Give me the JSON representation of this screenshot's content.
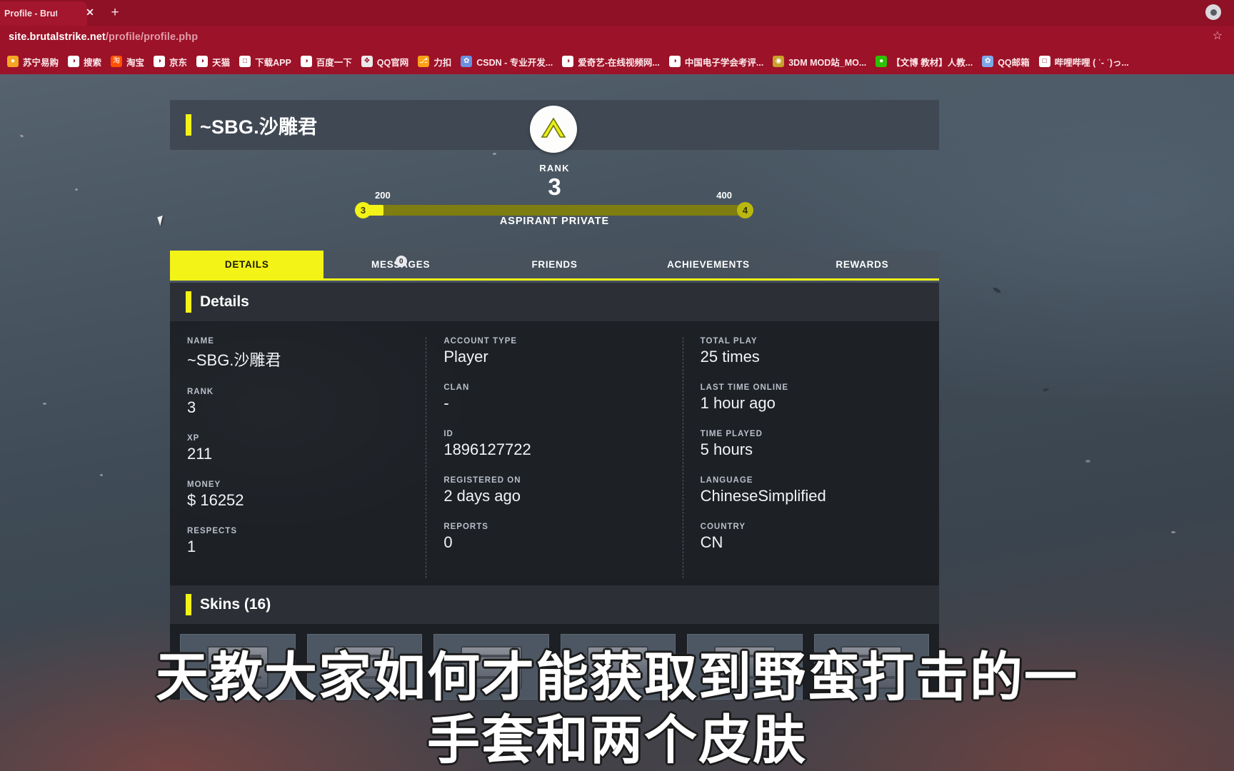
{
  "browser": {
    "tab": {
      "title": "Profile - Brutal S",
      "close_label": "✕"
    },
    "new_tab_label": "+",
    "url": {
      "host": "site.brutalstrike.net",
      "path": "/profile/profile.php"
    },
    "star_label": "☆",
    "theme_color": "#9c1228",
    "bookmarks": [
      {
        "label": "苏宁易购",
        "icon": "suning-icon",
        "icon_color": "#f5a623",
        "icon_glyph": "●"
      },
      {
        "label": "搜索",
        "icon": "globe-icon",
        "icon_color": "#ffffff",
        "icon_glyph": "◑"
      },
      {
        "label": "淘宝",
        "icon": "taobao-icon",
        "icon_color": "#ff5000",
        "icon_glyph": "淘"
      },
      {
        "label": "京东",
        "icon": "globe-icon",
        "icon_color": "#ffffff",
        "icon_glyph": "◑"
      },
      {
        "label": "天猫",
        "icon": "globe-icon",
        "icon_color": "#ffffff",
        "icon_glyph": "◑"
      },
      {
        "label": "下载APP",
        "icon": "bilibili-icon",
        "icon_color": "#ffffff",
        "icon_glyph": "□"
      },
      {
        "label": "百度一下",
        "icon": "globe-icon",
        "icon_color": "#ffffff",
        "icon_glyph": "◑"
      },
      {
        "label": "QQ官网",
        "icon": "qq-icon",
        "icon_color": "#eaeaea",
        "icon_glyph": "❖"
      },
      {
        "label": "力扣",
        "icon": "leetcode-icon",
        "icon_color": "#ffa116",
        "icon_glyph": "⎇"
      },
      {
        "label": "CSDN - 专业开发...",
        "icon": "csdn-icon",
        "icon_color": "#6c8fe0",
        "icon_glyph": "✿"
      },
      {
        "label": "爱奇艺-在线视频网...",
        "icon": "globe-icon",
        "icon_color": "#ffffff",
        "icon_glyph": "◑"
      },
      {
        "label": "中国电子学会考评...",
        "icon": "globe-icon",
        "icon_color": "#ffffff",
        "icon_glyph": "◑"
      },
      {
        "label": "3DM MOD站_MO...",
        "icon": "3dm-icon",
        "icon_color": "#c8a02a",
        "icon_glyph": "◉"
      },
      {
        "label": "【文博 教材】人教...",
        "icon": "wechat-icon",
        "icon_color": "#2dc100",
        "icon_glyph": "●"
      },
      {
        "label": "QQ邮箱",
        "icon": "baidu-icon",
        "icon_color": "#7fa8e8",
        "icon_glyph": "✿"
      },
      {
        "label": "哔哩哔哩 ( ˈ- ˈ)っ...",
        "icon": "bilibili-icon",
        "icon_color": "#ffffff",
        "icon_glyph": "□"
      }
    ]
  },
  "profile": {
    "username": "~SBG.沙雕君",
    "rank_badge_icon": "chevron-rank-insignia-icon",
    "rank_word": "RANK",
    "rank_number": "3",
    "rank_title": "ASPIRANT PRIVATE",
    "progress": {
      "current_node": "3",
      "next_node": "4",
      "min_xp": "200",
      "max_xp": "400",
      "percent": 5.5,
      "fill_color": "#f3f317",
      "track_color": "#7e7d12"
    },
    "tabs": [
      {
        "label": "DETAILS",
        "active": true,
        "badge": null
      },
      {
        "label": "MESSAGES",
        "active": false,
        "badge": "0"
      },
      {
        "label": "FRIENDS",
        "active": false,
        "badge": null
      },
      {
        "label": "ACHIEVEMENTS",
        "active": false,
        "badge": null
      },
      {
        "label": "REWARDS",
        "active": false,
        "badge": null
      }
    ],
    "details": {
      "panel_title": "Details",
      "columns": [
        [
          {
            "label": "NAME",
            "value": "~SBG.沙雕君"
          },
          {
            "label": "RANK",
            "value": "3"
          },
          {
            "label": "XP",
            "value": "211"
          },
          {
            "label": "MONEY",
            "value": "$ 16252"
          },
          {
            "label": "RESPECTS",
            "value": "1"
          }
        ],
        [
          {
            "label": "ACCOUNT TYPE",
            "value": "Player"
          },
          {
            "label": "CLAN",
            "value": "-"
          },
          {
            "label": "ID",
            "value": "1896127722"
          },
          {
            "label": "REGISTERED ON",
            "value": "2 days ago"
          },
          {
            "label": "REPORTS",
            "value": "0"
          }
        ],
        [
          {
            "label": "TOTAL PLAY",
            "value": "25 times"
          },
          {
            "label": "LAST TIME ONLINE",
            "value": "1 hour ago"
          },
          {
            "label": "TIME PLAYED",
            "value": "5 hours"
          },
          {
            "label": "LANGUAGE",
            "value": "ChineseSimplified"
          },
          {
            "label": "COUNTRY",
            "value": "CN"
          }
        ]
      ]
    },
    "skins": {
      "title": "Skins (16)",
      "items": [
        {
          "icon": "crate-icon"
        },
        {
          "icon": "crate-icon"
        },
        {
          "icon": "crate-icon"
        },
        {
          "icon": "crate-icon"
        },
        {
          "icon": "crate-icon"
        },
        {
          "icon": "crate-icon"
        }
      ]
    }
  },
  "subtitles": {
    "line1": "天教大家如何才能获取到野蛮打击的一",
    "line2": "手套和两个皮肤"
  }
}
